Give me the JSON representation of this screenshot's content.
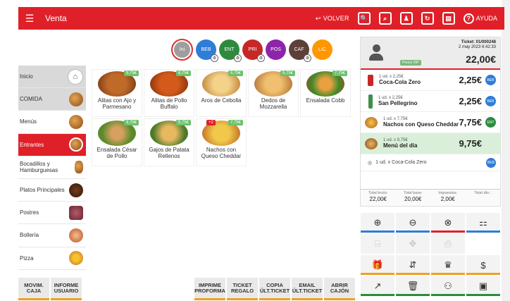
{
  "topbar": {
    "title": "Venta",
    "back_label": "VOLVER",
    "help_label": "AYUDA"
  },
  "category_circles": [
    {
      "label": "Ini",
      "color": "#9e9e9e"
    },
    {
      "label": "BEB",
      "color": "#2e7dd6"
    },
    {
      "label": "ENT",
      "color": "#2e8b3e"
    },
    {
      "label": "PRI",
      "color": "#c62828"
    },
    {
      "label": "POS",
      "color": "#8e24aa"
    },
    {
      "label": "CAF",
      "color": "#5d4037"
    },
    {
      "label": "LIC",
      "color": "#ff9800"
    }
  ],
  "sidebar": {
    "items": [
      {
        "label": "Inicio"
      },
      {
        "label": "COMIDA"
      },
      {
        "label": "Menús"
      },
      {
        "label": "Entrantes"
      },
      {
        "label": "Bocadillos y Hamburguesas"
      },
      {
        "label": "Platos Principales"
      },
      {
        "label": "Postres"
      },
      {
        "label": "Bollería"
      },
      {
        "label": "Pizza"
      }
    ]
  },
  "products": [
    {
      "name": "Alitas con Ajo y Parmesano",
      "price": "9,75€"
    },
    {
      "name": "Alitas de Pollo Buffalo",
      "price": "8,75€"
    },
    {
      "name": "Aros de Cebolla",
      "price": "5,75€"
    },
    {
      "name": "Dedos de Mozzarella",
      "price": "5,75€"
    },
    {
      "name": "Ensalada Cobb",
      "price": "7,75€"
    },
    {
      "name": "Ensalada César de Pollo",
      "price": "9,75€"
    },
    {
      "name": "Gajos de Patata Rellenos",
      "price": "5,75€"
    },
    {
      "name": "Nachos con Queso Cheddar",
      "price": "7,75€",
      "badge": "+2"
    }
  ],
  "ticket": {
    "vip_label": "Precio VIP",
    "number": "Ticket: 01/000248",
    "datetime": "2 may 2023 6:42:33",
    "total": "22,00€"
  },
  "lines": [
    {
      "qty": "1 ud. x 2,25€",
      "name": "Coca-Cola Zero",
      "amount": "2,25€",
      "cat": "BEB",
      "cat_color": "#2e7dd6"
    },
    {
      "qty": "1 ud. x 2,25€",
      "name": "San Pellegrino",
      "amount": "2,25€",
      "cat": "BEB",
      "cat_color": "#2e7dd6"
    },
    {
      "qty": "1 ud. x 7,75€",
      "name": "Nachos con Queso Cheddar",
      "amount": "7,75€",
      "cat": "ENT",
      "cat_color": "#2e8b3e"
    },
    {
      "qty": "1 ud. x 9,75€",
      "name": "Menú del día",
      "amount": "9,75€",
      "cat": "",
      "cat_color": ""
    }
  ],
  "subline": {
    "text": "1 ud. x Coca-Cola Zero",
    "cat": "BEB"
  },
  "totals": {
    "gross_label": "Total bruto:",
    "gross": "22,00€",
    "base_label": "Total base:",
    "base": "20,00€",
    "tax_label": "Impuestos:",
    "tax": "2,00€",
    "disc_label": "Total dto.:",
    "disc": ""
  },
  "actions": [
    {
      "icon": "⊕",
      "name": "add",
      "bar": "#2e7dd6"
    },
    {
      "icon": "⊖",
      "name": "subtract",
      "bar": "#2e7dd6"
    },
    {
      "icon": "⊗",
      "name": "delete-line",
      "bar": "#e02028"
    },
    {
      "icon": "⚏",
      "name": "split",
      "bar": "#2e7dd6"
    },
    {
      "icon": "⍈",
      "name": "move",
      "bar": ""
    },
    {
      "icon": "✥",
      "name": "transfer",
      "bar": ""
    },
    {
      "icon": "⎙",
      "name": "print",
      "bar": ""
    },
    {
      "icon": "",
      "name": "blank",
      "bar": ""
    },
    {
      "icon": "🎁",
      "name": "gift",
      "bar": "#f0a020"
    },
    {
      "icon": "⇵",
      "name": "swap",
      "bar": "#f0a020"
    },
    {
      "icon": "♛",
      "name": "chef",
      "bar": "#f0a020"
    },
    {
      "icon": "$",
      "name": "price",
      "bar": "#f0a020"
    },
    {
      "icon": "↗",
      "name": "edit",
      "bar": "#2e8b3e"
    },
    {
      "icon": "🗑",
      "name": "trash",
      "bar": "#2e8b3e"
    },
    {
      "icon": "⚇",
      "name": "customer",
      "bar": "#2e8b3e"
    },
    {
      "icon": "▣",
      "name": "pay",
      "bar": "#2e8b3e"
    }
  ],
  "bottom_buttons": [
    {
      "label": "MOVIM. CAJA"
    },
    {
      "label": "INFORME USUARIO"
    },
    {
      "label": "IMPRIME PROFORMA"
    },
    {
      "label": "TICKET REGALO"
    },
    {
      "label": "COPIA ÚLT.TICKET"
    },
    {
      "label": "EMAIL ÚLT.TICKET"
    },
    {
      "label": "ABRIR CAJÓN"
    }
  ]
}
